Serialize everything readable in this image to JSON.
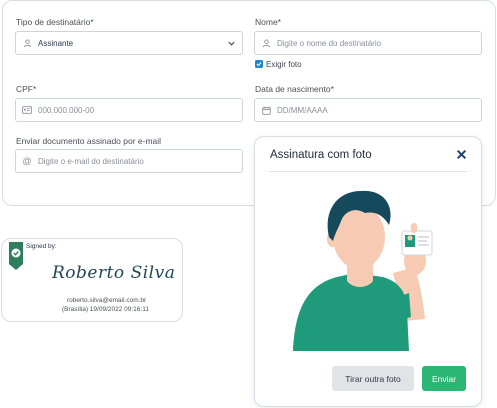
{
  "form": {
    "recipient_type_label": "Tipo de destinatário*",
    "recipient_type_value": "Assinante",
    "name_label": "Nome*",
    "name_placeholder": "Digite o nome do destinatário",
    "require_photo_label": "Exigir foto",
    "cpf_label": "CPF*",
    "cpf_placeholder": "000.000.000-00",
    "birthdate_label": "Data de nascimento*",
    "birthdate_placeholder": "DD/MM/AAAA",
    "email_label": "Enviar documento assinado por e-mail",
    "email_placeholder": "Digite o e-mail do destinatário"
  },
  "signature": {
    "signed_by": "Signed by:",
    "name": "Roberto Silva",
    "email": "roberto.silva@email.com.br",
    "date": "(Brasília) 19/09/2022 09:16:11"
  },
  "modal": {
    "title": "Assinatura com foto",
    "retake_label": "Tirar outra foto",
    "send_label": "Enviar"
  },
  "colors": {
    "accent_blue": "#1e88c8",
    "primary_green": "#2bb673",
    "shirt_teal": "#1f9a7a",
    "shield_green": "#2e7d5b"
  },
  "icons": [
    "person-icon",
    "user-icon",
    "id-card-icon",
    "calendar-icon",
    "at-icon",
    "chevron-down-icon",
    "check-icon",
    "shield-check-icon",
    "close-icon"
  ]
}
